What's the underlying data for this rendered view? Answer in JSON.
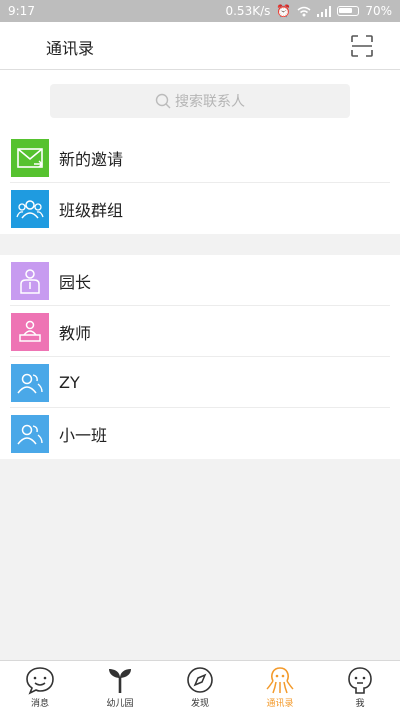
{
  "status_bar": {
    "time": "9:17",
    "speed": "0.53K/s",
    "battery": "70%"
  },
  "header": {
    "title": "通讯录"
  },
  "search": {
    "placeholder": "搜索联系人"
  },
  "top_items": [
    {
      "label": "新的邀请",
      "color": "#56c22f"
    },
    {
      "label": "班级群组",
      "color": "#1f9be0"
    }
  ],
  "contacts": [
    {
      "label": "园长",
      "color": "#c79bf0"
    },
    {
      "label": "教师",
      "color": "#ee74b4"
    },
    {
      "label": "ZY",
      "color": "#4aa8e8"
    },
    {
      "label": "小一班",
      "color": "#4aa8e8"
    }
  ],
  "tabs": [
    {
      "label": "消息"
    },
    {
      "label": "幼儿园"
    },
    {
      "label": "发现"
    },
    {
      "label": "通讯录",
      "active": true,
      "color": "#f39a2b"
    },
    {
      "label": "我"
    }
  ]
}
